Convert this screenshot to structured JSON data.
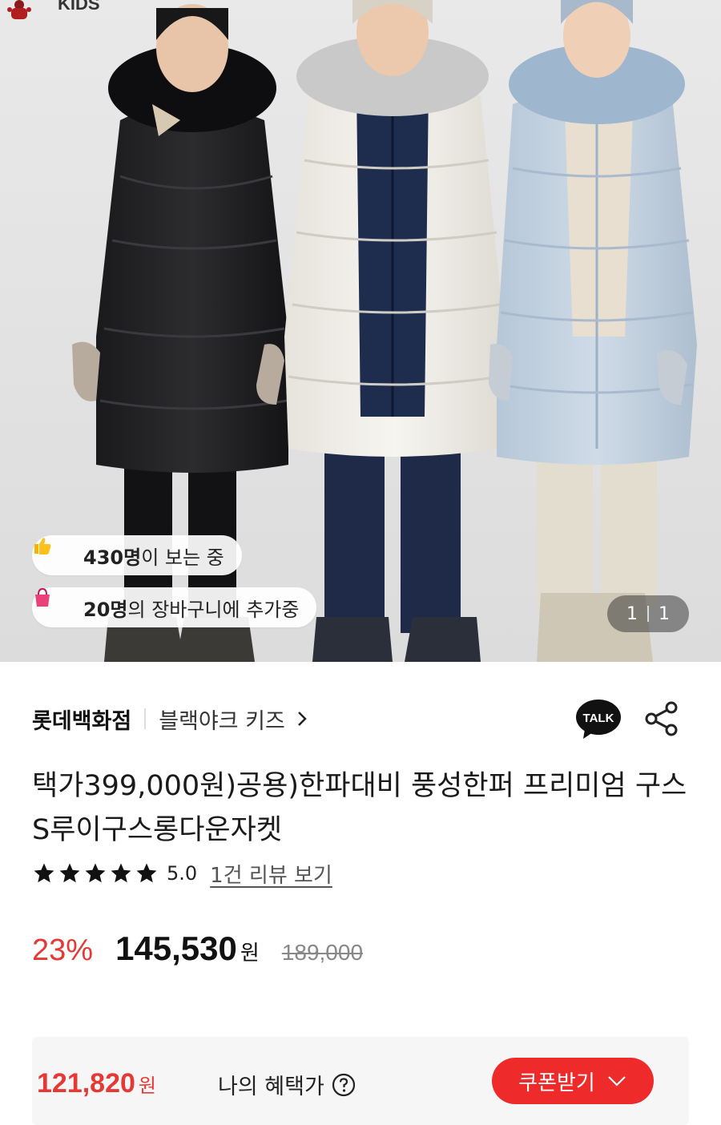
{
  "hero": {
    "brand_text": "KIDS",
    "viewers": {
      "count": "430명",
      "suffix": "이 보는 중"
    },
    "cart": {
      "count": "20명",
      "suffix": "의 장바구니에 추가중"
    },
    "image_counter": {
      "current": "1",
      "total": "1"
    }
  },
  "seller": {
    "store": "롯데백화점",
    "brand": "블랙야크 키즈",
    "talk_label": "TALK"
  },
  "product": {
    "title": "택가399,000원)공용)한파대비 풍성한퍼 프리미엄 구스 S루이구스롱다운자켓",
    "rating": {
      "stars": 5,
      "value": "5.0",
      "review_link": "1건 리뷰 보기"
    }
  },
  "price": {
    "discount": "23%",
    "sale_price": "145,530",
    "won": "원",
    "original_price": "189,000"
  },
  "benefit": {
    "price": "121,820",
    "won": "원",
    "label": "나의 혜택가",
    "coupon_button": "쿠폰받기"
  },
  "colors": {
    "accent_red": "#e53935",
    "coupon_red": "#ee2a2a"
  }
}
